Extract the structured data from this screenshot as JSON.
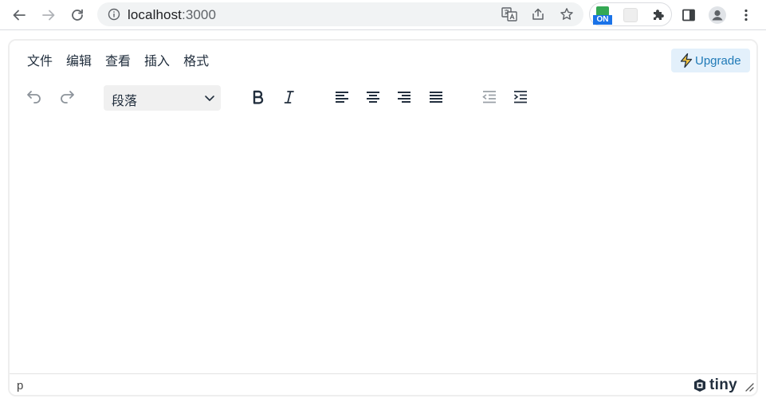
{
  "browser": {
    "url_host": "localhost",
    "url_port": ":3000",
    "extension_badge": "ON"
  },
  "editor": {
    "menu": [
      "文件",
      "编辑",
      "查看",
      "插入",
      "格式"
    ],
    "upgrade_label": "Upgrade",
    "block_format": "段落",
    "status_path": "p",
    "brand": "tiny"
  },
  "colors": {
    "icon_dark": "#222f3e",
    "icon_muted": "#9aa0a6",
    "upgrade_bg": "#e3f0fb",
    "upgrade_text": "#207ab7",
    "badge_blue": "#1a73e8",
    "badge_green": "#34a853"
  }
}
